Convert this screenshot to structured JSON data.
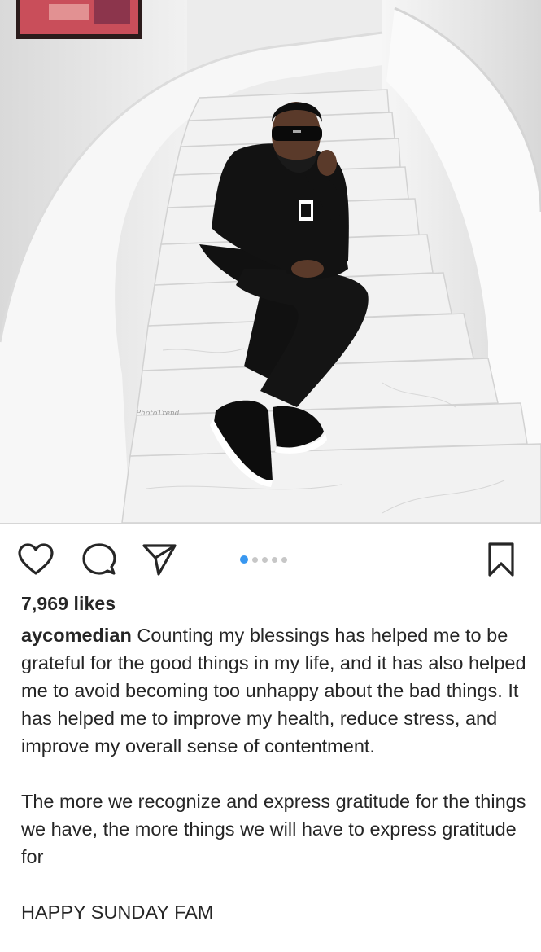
{
  "post": {
    "image_alt": "Man in black outfit and sunglasses sitting on white marble spiral staircase",
    "photo_signature": "PhotoTrend",
    "likes_text": "7,969 likes",
    "carousel": {
      "count": 5,
      "active_index": 0
    },
    "caption": {
      "username": "aycomedian",
      "paragraph1": "Counting my blessings has helped me to be grateful for the good things in my life, and it has also helped me to avoid becoming too unhappy about the bad things. It has helped me to improve my health, reduce stress, and improve my overall sense of contentment.",
      "paragraph2": "The more we recognize and express gratitude for the things we have, the more things we will have to express gratitude for",
      "paragraph3": "HAPPY SUNDAY FAM"
    }
  },
  "icons": {
    "like": "heart-outline-icon",
    "comment": "comment-bubble-icon",
    "share": "paper-plane-icon",
    "save": "bookmark-icon"
  },
  "colors": {
    "text": "#262626",
    "dot_active": "#3897f0",
    "dot_inactive": "#c7c7c7"
  }
}
